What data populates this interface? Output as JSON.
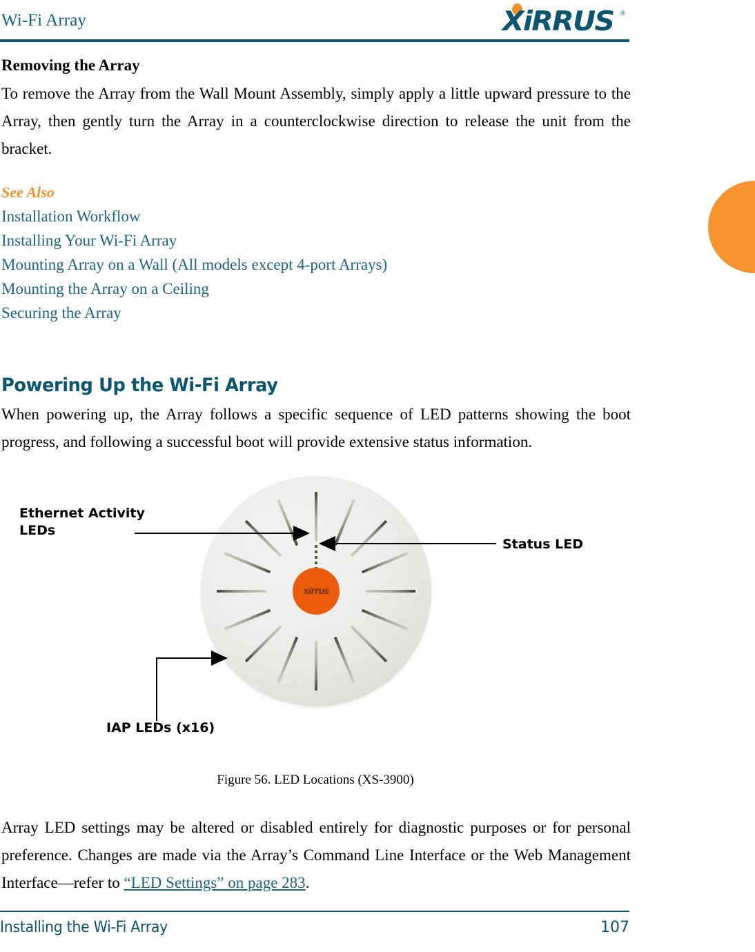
{
  "header": {
    "title": "Wi-Fi Array",
    "logo_text": "XiRRUS",
    "logo_registered": "®"
  },
  "sections": {
    "removing": {
      "heading": "Removing the Array",
      "paragraph": "To remove the Array from the Wall Mount Assembly, simply apply a little upward pressure to the Array, then gently turn the Array in a counterclockwise direction to release the unit from the bracket."
    },
    "see_also": {
      "label": "See Also",
      "links": [
        "Installation Workflow",
        "Installing Your Wi-Fi Array",
        "Mounting Array on a Wall (All models except 4-port Arrays)",
        "Mounting the Array on a Ceiling",
        "Securing the Array"
      ]
    },
    "powering_up": {
      "heading": "Powering Up the Wi-Fi Array",
      "paragraph": "When powering up, the Array follows a specific sequence of LED patterns showing the boot progress, and following a successful boot will provide extensive status information."
    },
    "closing": {
      "text_before": "Array LED settings may be altered or disabled entirely for diagnostic purposes or for personal preference. Changes are made via the Array’s Command Line Interface or the Web Management Interface—refer to ",
      "link_text": "“LED Settings” on page 283",
      "text_after": "."
    }
  },
  "figure": {
    "caption": "Figure 56. LED Locations (XS-3900)",
    "device_badge": "xirrus",
    "callouts": {
      "ethernet": "Ethernet Activity\nLEDs",
      "status": "Status LED",
      "iap": "IAP LEDs (x16)"
    }
  },
  "footer": {
    "left": "Installing the Wi-Fi Array",
    "page_number": "107"
  },
  "colors": {
    "brand_teal": "#0a5570",
    "link_teal": "#1a6484",
    "accent_orange": "#f5902f",
    "badge_orange": "#ea5b0c"
  }
}
